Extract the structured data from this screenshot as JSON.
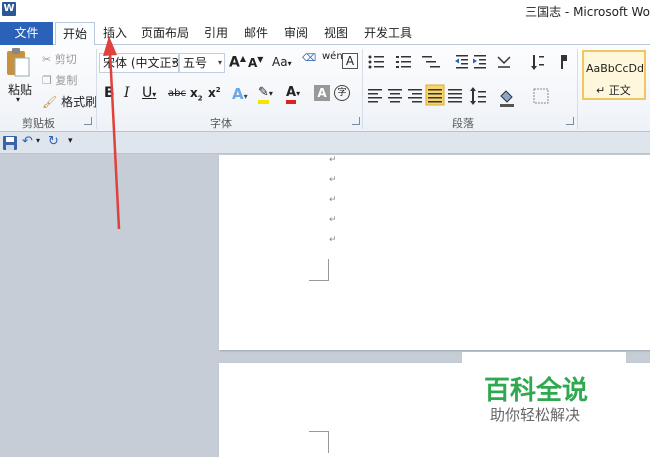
{
  "window": {
    "app_icon": "W",
    "title": "三国志 - Microsoft Wo"
  },
  "tabs": [
    "文件",
    "开始",
    "插入",
    "页面布局",
    "引用",
    "邮件",
    "审阅",
    "视图",
    "开发工具"
  ],
  "clipboard": {
    "paste_label": "粘贴",
    "cut_label": "剪切",
    "copy_label": "复制",
    "format_painter_label": "格式刷",
    "group_label": "剪贴板"
  },
  "font": {
    "font_name": "宋体 (中文正3",
    "font_size": "五号",
    "grow_font": "A",
    "shrink_font": "A",
    "change_case": "Aa",
    "phonetic_guide": "wén",
    "char_border": "A",
    "bold": "B",
    "italic": "I",
    "underline": "U",
    "strikethrough": "abc",
    "subscript": "x",
    "superscript": "x",
    "text_effects": "A",
    "font_color": "A",
    "char_shading": "A",
    "enclose_char": "字",
    "group_label": "字体"
  },
  "paragraph": {
    "group_label": "段落"
  },
  "styles": {
    "preview_text": "AaBbCcDdI",
    "style_name": "↵ 正文"
  },
  "document": {
    "paragraph_mark": "↵"
  },
  "watermark": {
    "main": "百科全说",
    "sub": "助你轻松解决"
  },
  "colors": {
    "file_tab": "#2a62b9",
    "annotation_arrow": "#e0413d",
    "watermark_green": "#2fa84f",
    "highlight_yellow": "#f5e400",
    "font_red": "#e02020"
  }
}
